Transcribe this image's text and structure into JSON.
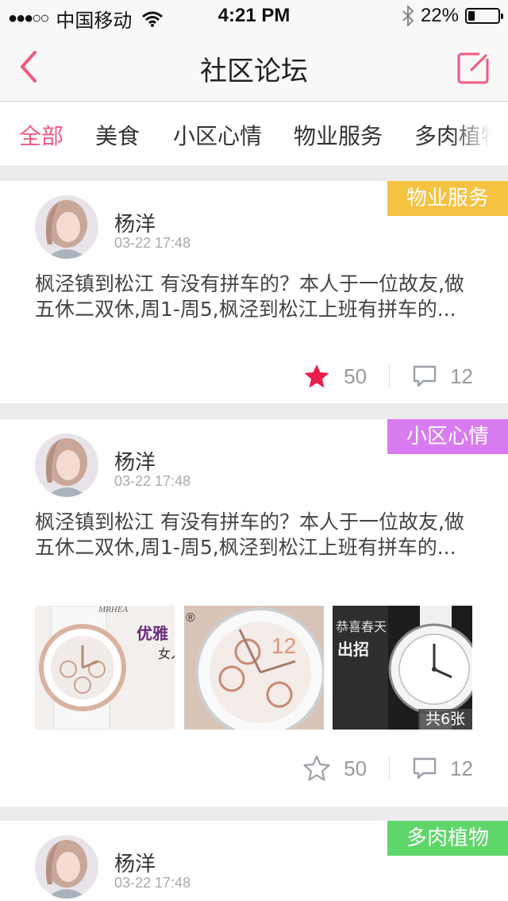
{
  "status_bar": {
    "signal": "●●●○○",
    "carrier": "中国移动",
    "time": "4:21 PM",
    "battery": "22%",
    "battery_level": 0.22
  },
  "nav": {
    "title": "社区论坛",
    "back_icon": "chevron-left-icon",
    "edit_icon": "compose-icon",
    "accent": "#f05a7e"
  },
  "tabs": [
    {
      "label": "全部",
      "active": true
    },
    {
      "label": "美食"
    },
    {
      "label": "小区心情"
    },
    {
      "label": "物业服务"
    },
    {
      "label": "多肉植物"
    }
  ],
  "posts": [
    {
      "category": "物业服务",
      "category_color": "#f5c242",
      "user": "杨洋",
      "time": "03-22 17:48",
      "content": "枫泾镇到松江 有没有拼车的？本人于一位故友,做五休二双休,周1-周5,枫泾到松江上班有拼车的...",
      "likes": "50",
      "comments": "12",
      "liked": true
    },
    {
      "category": "小区心情",
      "category_color": "#d97bf0",
      "user": "杨洋",
      "time": "03-22 17:48",
      "content": "枫泾镇到松江 有没有拼车的？本人于一位故友,做五休二双休,周1-周5,枫泾到松江上班有拼车的...",
      "images": [
        {
          "brand": "MRHEA",
          "caption": "优雅",
          "sub": "女人"
        },
        {
          "mark": "®",
          "dial": "12"
        },
        {
          "caption": "恭喜春天",
          "sub": "出招"
        }
      ],
      "image_count": "共6张",
      "likes": "50",
      "comments": "12",
      "liked": false
    },
    {
      "category": "多肉植物",
      "category_color": "#5fd66a",
      "user": "杨洋",
      "time": "03-22 17:48"
    }
  ]
}
